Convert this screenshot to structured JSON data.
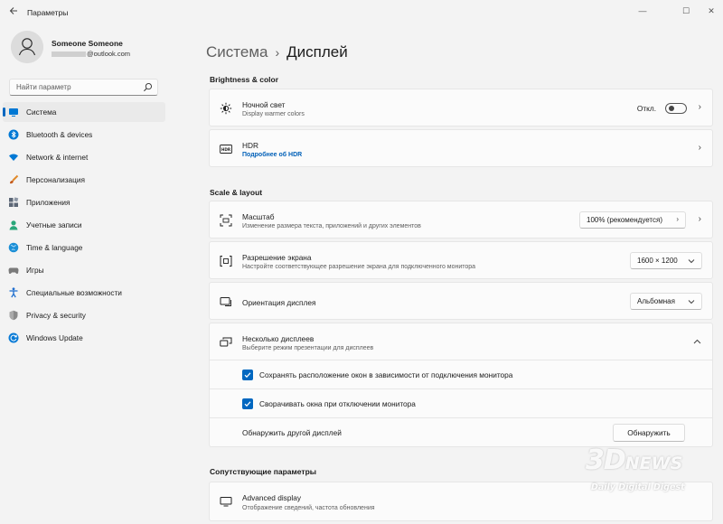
{
  "window": {
    "title": "Параметры",
    "back_icon": "back-arrow-icon",
    "minimize_glyph": "—",
    "maximize_glyph": "☐",
    "close_glyph": "✕"
  },
  "profile": {
    "name": "Someone Someone",
    "email_domain": "@outlook.com"
  },
  "search": {
    "placeholder": "Найти параметр",
    "icon": "search-icon"
  },
  "sidebar": {
    "items": [
      {
        "label": "Система",
        "icon": "system-icon",
        "active": true,
        "color": "#0078d4"
      },
      {
        "label": "Bluetooth & devices",
        "icon": "bluetooth-icon",
        "color": "#0078d4"
      },
      {
        "label": "Network & internet",
        "icon": "wifi-icon",
        "color": "#0078d4"
      },
      {
        "label": "Персонализация",
        "icon": "brush-icon",
        "color": "#e08a2b"
      },
      {
        "label": "Приложения",
        "icon": "apps-icon",
        "color": "#5b6676"
      },
      {
        "label": "Учетные записи",
        "icon": "account-icon",
        "color": "#2aa77a"
      },
      {
        "label": "Time & language",
        "icon": "globe-icon",
        "color": "#1b8fd6"
      },
      {
        "label": "Игры",
        "icon": "gamepad-icon",
        "color": "#7a7a7a"
      },
      {
        "label": "Специальные возможности",
        "icon": "accessibility-icon",
        "color": "#1f6fcf"
      },
      {
        "label": "Privacy & security",
        "icon": "shield-icon",
        "color": "#8a8a8a"
      },
      {
        "label": "Windows Update",
        "icon": "update-icon",
        "color": "#0a7bd6"
      }
    ]
  },
  "breadcrumb": {
    "parent": "Система",
    "separator": "›",
    "current": "Дисплей"
  },
  "sections": {
    "brightness": "Brightness & color",
    "scale": "Scale & layout",
    "related": "Сопутствующие параметры"
  },
  "night_light": {
    "title": "Ночной свет",
    "subtitle": "Display warmer colors",
    "state_label": "Откл.",
    "on": false
  },
  "hdr": {
    "title": "HDR",
    "link": "Подробнее об HDR",
    "icon_text": "HDR"
  },
  "scale": {
    "title": "Масштаб",
    "subtitle": "Изменение размера текста, приложений и других элементов",
    "value": "100% (рекомендуется)"
  },
  "resolution": {
    "title": "Разрешение экрана",
    "subtitle": "Настройте соответствующее разрешение экрана для подключенного монитора",
    "value": "1600 × 1200"
  },
  "orientation": {
    "title": "Ориентация дисплея",
    "value": "Альбомная"
  },
  "multi_display": {
    "title": "Несколько дисплеев",
    "subtitle": "Выберите режим презентации для дисплеев",
    "remember_label": "Сохранять расположение окон в зависимости от подключения монитора",
    "remember_checked": true,
    "minimize_label": "Сворачивать окна при отключении монитора",
    "minimize_checked": true,
    "detect_label": "Обнаружить другой дисплей",
    "detect_button": "Обнаружить"
  },
  "advanced": {
    "title": "Advanced display",
    "subtitle": "Отображение сведений, частота обновления"
  },
  "watermark": {
    "main": "3D",
    "news": "NEWS",
    "sub": "Daily Digital Digest"
  },
  "accent_color": "#0067c0"
}
